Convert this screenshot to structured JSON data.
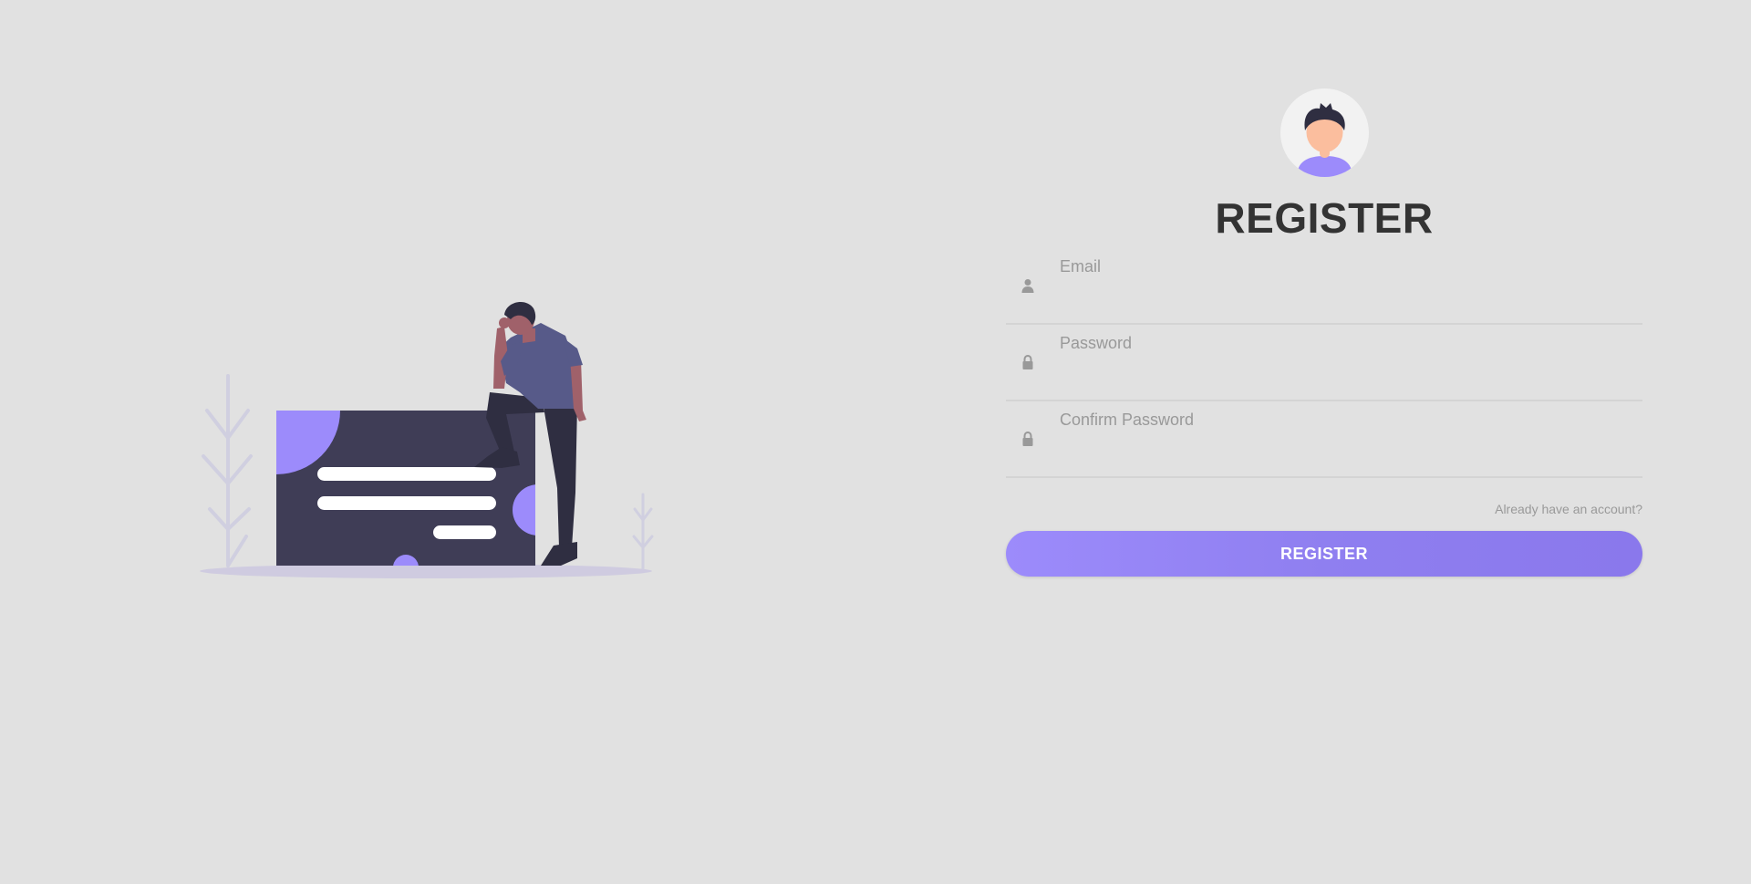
{
  "colors": {
    "background": "#e1e1e1",
    "accent": "#9c8bfb",
    "accent_dark": "#8a78ec",
    "title": "#333333",
    "muted_text": "#999999",
    "card": "#3f3d56"
  },
  "form": {
    "title": "REGISTER",
    "fields": [
      {
        "label": "Email",
        "icon": "user-icon",
        "value": ""
      },
      {
        "label": "Password",
        "icon": "lock-icon",
        "value": ""
      },
      {
        "label": "Confirm Password",
        "icon": "lock-icon",
        "value": ""
      }
    ],
    "account_link": "Already have an account?",
    "submit_label": "REGISTER"
  }
}
